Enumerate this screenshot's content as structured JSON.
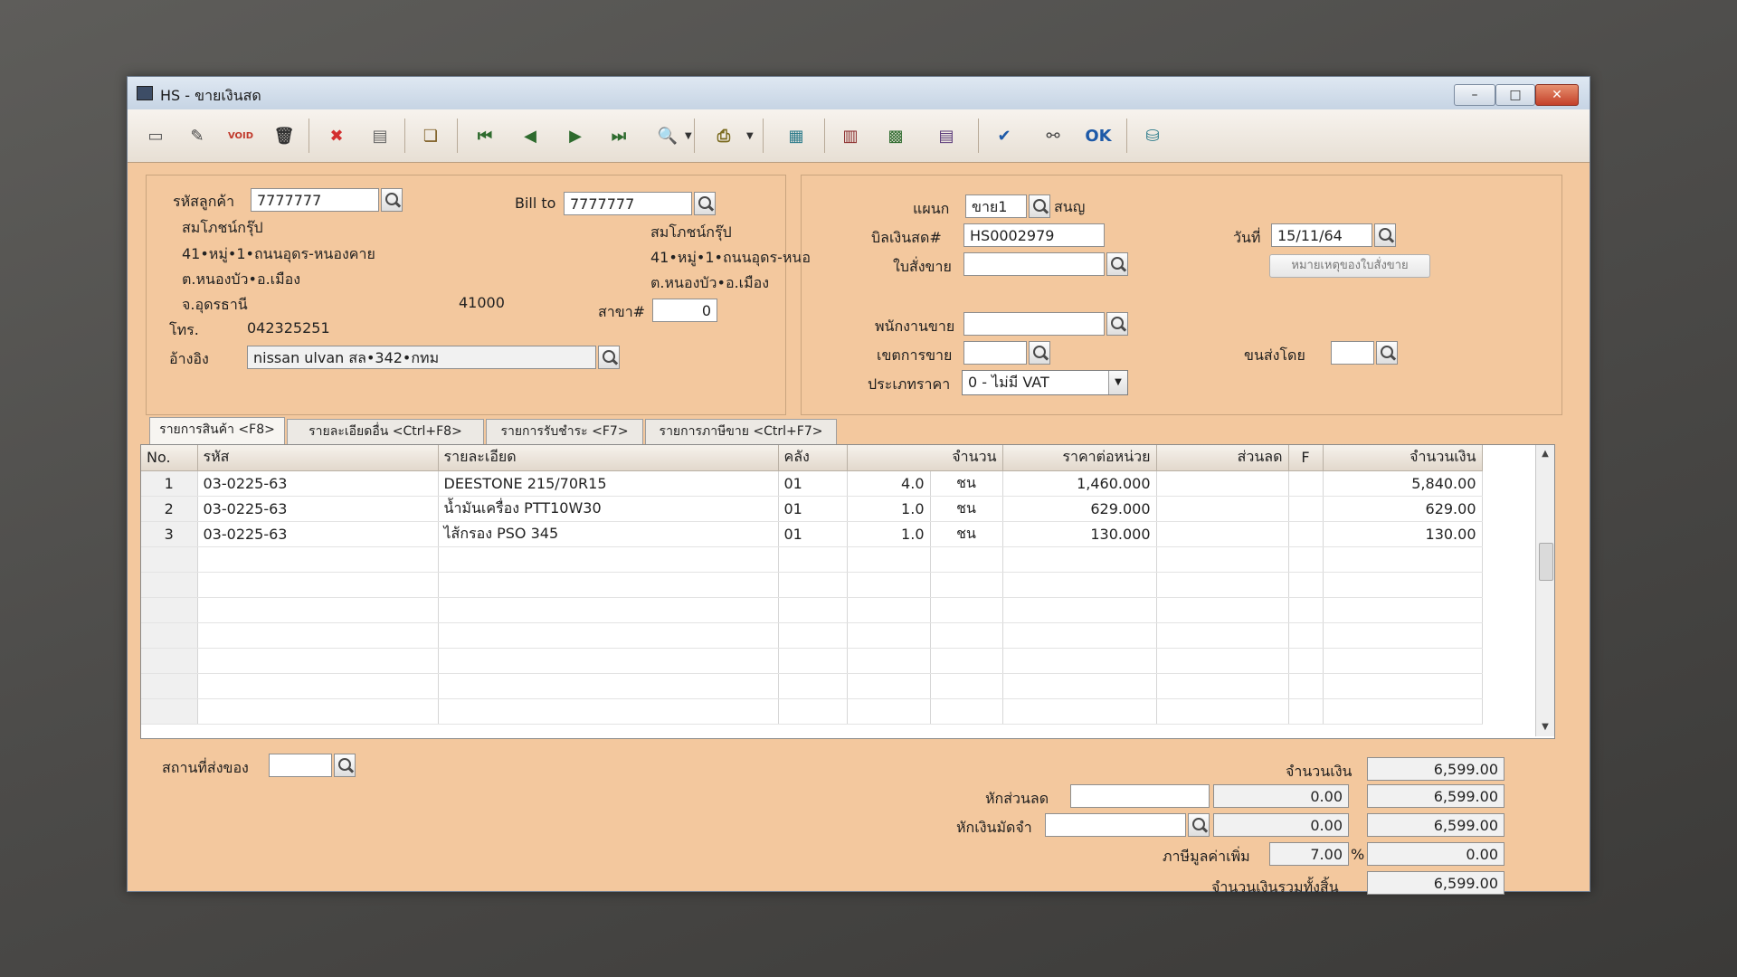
{
  "window": {
    "title": "HS - ขายเงินสด",
    "min": "–",
    "max": "□",
    "close": "✕"
  },
  "toolbar": [
    {
      "name": "new-icon",
      "glyph": "▭",
      "color": "#555"
    },
    {
      "name": "edit-icon",
      "glyph": "✎",
      "color": "#444"
    },
    {
      "name": "void-icon",
      "glyph": "VOID",
      "color": "#c0392b"
    },
    {
      "name": "delete-icon",
      "glyph": "🗑",
      "color": "#333"
    },
    {
      "name": "cancel-icon",
      "glyph": "✖",
      "color": "#d32f2f"
    },
    {
      "name": "save-icon",
      "glyph": "▤",
      "color": "#666"
    },
    {
      "name": "copy-icon",
      "glyph": "❏",
      "color": "#7a5a1e"
    },
    {
      "name": "first-record-icon",
      "glyph": "⏮",
      "color": "#2e6b2e"
    },
    {
      "name": "previous-record-icon",
      "glyph": "◀",
      "color": "#2e6b2e"
    },
    {
      "name": "next-record-icon",
      "glyph": "▶",
      "color": "#2e6b2e"
    },
    {
      "name": "last-record-icon",
      "glyph": "⏭",
      "color": "#2e6b2e"
    },
    {
      "name": "find-icon",
      "glyph": "🔍",
      "color": "#333"
    },
    {
      "name": "print-icon",
      "glyph": "⎙",
      "color": "#7a6a1e"
    },
    {
      "name": "report-icon",
      "glyph": "▦",
      "color": "#2a7a8a"
    },
    {
      "name": "form-icon",
      "glyph": "▥",
      "color": "#8a2a2a"
    },
    {
      "name": "calculator-icon",
      "glyph": "▩",
      "color": "#2e6b2e"
    },
    {
      "name": "reuse-icon",
      "glyph": "▤",
      "color": "#5a3a7a"
    },
    {
      "name": "approve-icon",
      "glyph": "✔",
      "color": "#1e5aa8"
    },
    {
      "name": "link-icon",
      "glyph": "⚯",
      "color": "#444"
    },
    {
      "name": "ok-icon",
      "glyph": "OK",
      "color": "#1e5aa8"
    },
    {
      "name": "network-icon",
      "glyph": "⛁",
      "color": "#2a7a8a"
    }
  ],
  "customer": {
    "code_label": "รหัสลูกค้า",
    "code": "7777777",
    "name": "สมโภชน์กรุ๊ป",
    "address1": "41•หมู่•1•ถนนอุดร-หนองคาย",
    "address2": "ต.หนองบัว•อ.เมือง",
    "address3": "จ.อุดรธานี",
    "postcode": "41000",
    "phone_label": "โทร.",
    "phone": "042325251",
    "ref_label": "อ้างอิง",
    "ref": "nissan ulvan สล•342•กทม"
  },
  "billto": {
    "label": "Bill to",
    "code": "7777777",
    "name": "สมโภชน์กรุ๊ป",
    "address1": "41•หมู่•1•ถนนอุดร-หนอ",
    "address2": "ต.หนองบัว•อ.เมือง",
    "branch_label": "สาขา#",
    "branch": "0"
  },
  "doc": {
    "dept_label": "แผนก",
    "dept": "ขาย1",
    "dept_name": "สนญ",
    "bill_label": "บิลเงินสด#",
    "bill": "HS0002979",
    "order_label": "ใบสั่งขาย",
    "order": "",
    "date_label": "วันที่",
    "date": "15/11/64",
    "note_button": "หมายเหตุของใบสั่งขาย",
    "salesman_label": "พนักงานขาย",
    "salesman": "",
    "area_label": "เขตการขาย",
    "area": "",
    "ship_label": "ขนส่งโดย",
    "ship": "",
    "price_type_label": "ประเภทราคา",
    "price_type": "0 - ไม่มี VAT"
  },
  "tabs": [
    {
      "label": "รายการสินค้า <F8>"
    },
    {
      "label": "รายละเอียดอื่น <Ctrl+F8>"
    },
    {
      "label": "รายการรับชำระ <F7>"
    },
    {
      "label": "รายการภาษีขาย <Ctrl+F7>"
    }
  ],
  "grid": {
    "headers": {
      "no": "No.",
      "code": "รหัส",
      "desc": "รายละเอียด",
      "wh": "คลัง",
      "qty": "จำนวน",
      "price": "ราคาต่อหน่วย",
      "discount": "ส่วนลด",
      "f": "F",
      "amount": "จำนวนเงิน"
    },
    "rows": [
      {
        "no": "1",
        "code": "03-0225-63",
        "desc": "DEESTONE 215/70R15",
        "wh": "01",
        "qty": "4.0",
        "unit": "ชน",
        "price": "1,460.000",
        "discount": "",
        "f": "",
        "amount": "5,840.00"
      },
      {
        "no": "2",
        "code": "03-0225-63",
        "desc": "น้ำมันเครื่อง PTT10W30",
        "wh": "01",
        "qty": "1.0",
        "unit": "ชน",
        "price": "629.000",
        "discount": "",
        "f": "",
        "amount": "629.00"
      },
      {
        "no": "3",
        "code": "03-0225-63",
        "desc": "ไส้กรอง PSO 345",
        "wh": "01",
        "qty": "1.0",
        "unit": "ชน",
        "price": "130.000",
        "discount": "",
        "f": "",
        "amount": "130.00"
      }
    ]
  },
  "footer": {
    "ship_place_label": "สถานที่ส่งของ",
    "ship_place": "",
    "amount_label": "จำนวนเงิน",
    "amount": "6,599.00",
    "discount_label": "หักส่วนลด",
    "discount_text": "",
    "discount_value": "0.00",
    "after_discount": "6,599.00",
    "deposit_label": "หักเงินมัดจำ",
    "deposit_text": "",
    "deposit_value": "0.00",
    "after_deposit": "6,599.00",
    "vat_label": "ภาษีมูลค่าเพิ่ม",
    "vat_rate": "7.00",
    "vat_pct": "%",
    "vat_amount": "0.00",
    "total_label": "จำนวนเงินรวมทั้งสิ้น",
    "total": "6,599.00"
  }
}
